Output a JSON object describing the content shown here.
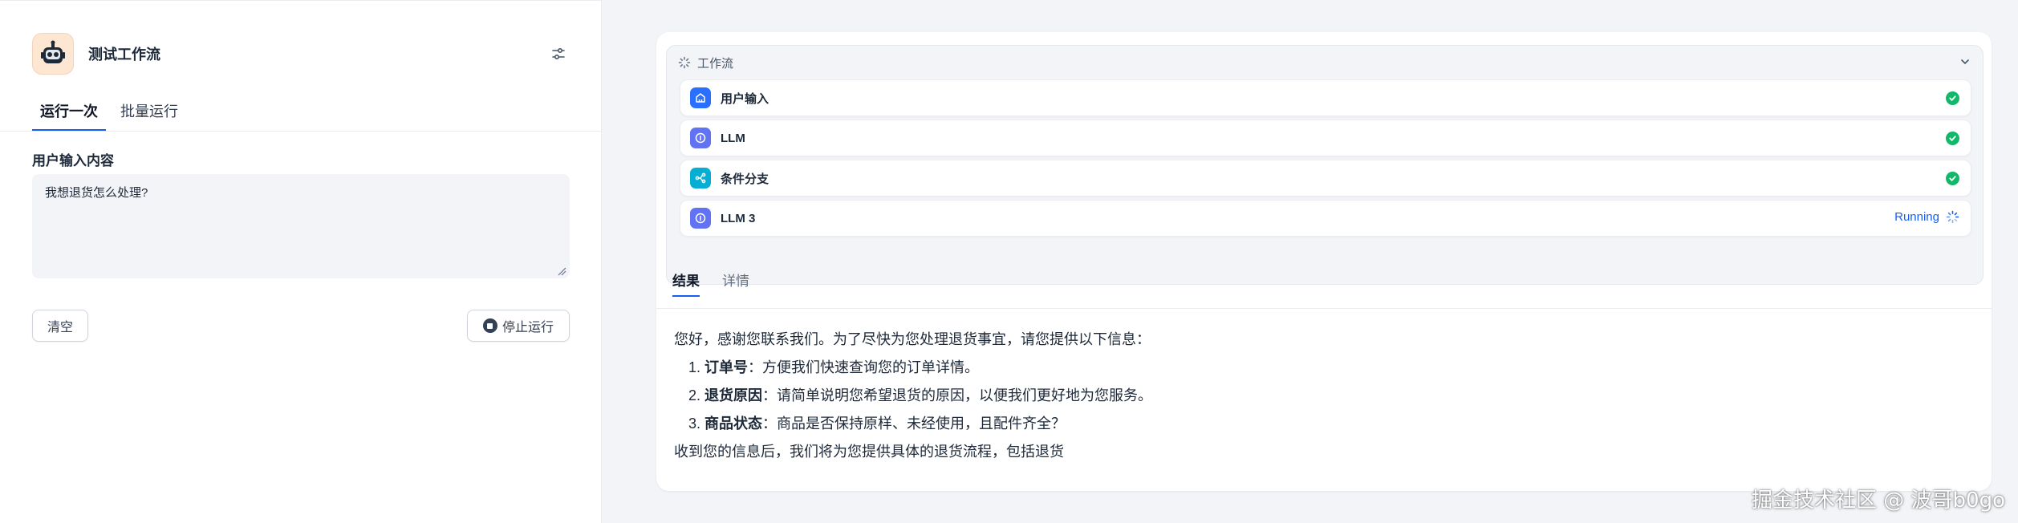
{
  "app": {
    "title": "测试工作流",
    "icon": "robot-icon"
  },
  "left_tabs": [
    {
      "label": "运行一次",
      "active": true
    },
    {
      "label": "批量运行",
      "active": false
    }
  ],
  "input": {
    "label": "用户输入内容",
    "value": "我想退货怎么处理?"
  },
  "buttons": {
    "clear": "清空",
    "stop": "停止运行"
  },
  "workflow": {
    "title": "工作流",
    "nodes": [
      {
        "name": "用户输入",
        "icon": "home-icon",
        "status": "success",
        "color": "#2970ff"
      },
      {
        "name": "LLM",
        "icon": "llm-icon",
        "status": "success",
        "color": "#6172f3"
      },
      {
        "name": "条件分支",
        "icon": "branch-icon",
        "status": "success",
        "color": "#06aed4"
      },
      {
        "name": "LLM 3",
        "icon": "llm-icon",
        "status": "running",
        "status_label": "Running",
        "color": "#6172f3"
      }
    ]
  },
  "right_tabs": [
    {
      "label": "结果",
      "active": true
    },
    {
      "label": "详情",
      "active": false
    }
  ],
  "result": {
    "intro": "您好，感谢您联系我们。为了尽快为您处理退货事宜，请您提供以下信息：",
    "items": [
      {
        "title": "订单号",
        "text": "：方便我们快速查询您的订单详情。"
      },
      {
        "title": "退货原因",
        "text": "：请简单说明您希望退货的原因，以便我们更好地为您服务。"
      },
      {
        "title": "商品状态",
        "text": "：商品是否保持原样、未经使用，且配件齐全？"
      }
    ],
    "outro": "收到您的信息后，我们将为您提供具体的退货流程，包括退货"
  },
  "watermark": "掘金技术社区 @ 波哥b0go",
  "colors": {
    "accent": "#155eef",
    "success": "#12b76a"
  }
}
